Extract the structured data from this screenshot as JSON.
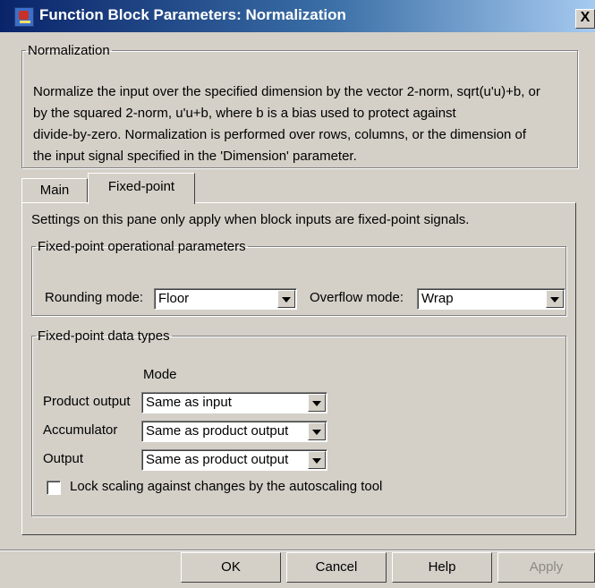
{
  "window": {
    "title": "Function Block Parameters: Normalization",
    "icon": "simulink-block-icon",
    "close_label": "X"
  },
  "normalization": {
    "legend": "Normalization",
    "description_lines": [
      "Normalize the input over the specified dimension by the vector 2-norm, sqrt(u'u)+b, or",
      "by the squared 2-norm, u'u+b, where b is a bias used to protect against",
      "divide-by-zero.  Normalization is performed over rows, columns, or the dimension of",
      "the input signal specified in the 'Dimension' parameter."
    ]
  },
  "tabs": [
    {
      "label": "Main",
      "selected": false
    },
    {
      "label": "Fixed-point",
      "selected": true
    }
  ],
  "fixed_point": {
    "note": "Settings on this pane only apply when block inputs are fixed-point signals.",
    "operational": {
      "legend": "Fixed-point operational parameters",
      "rounding_label": "Rounding mode:",
      "rounding_value": "Floor",
      "overflow_label": "Overflow mode:",
      "overflow_value": "Wrap"
    },
    "data_types": {
      "legend": "Fixed-point data types",
      "mode_header": "Mode",
      "rows": [
        {
          "label": "Product output",
          "value": "Same as input"
        },
        {
          "label": "Accumulator",
          "value": "Same as product output"
        },
        {
          "label": "Output",
          "value": "Same as product output"
        }
      ],
      "lock_label": "Lock scaling against changes by the autoscaling tool",
      "lock_checked": false
    }
  },
  "buttons": {
    "ok": "OK",
    "cancel": "Cancel",
    "help": "Help",
    "apply": "Apply",
    "apply_enabled": false
  }
}
